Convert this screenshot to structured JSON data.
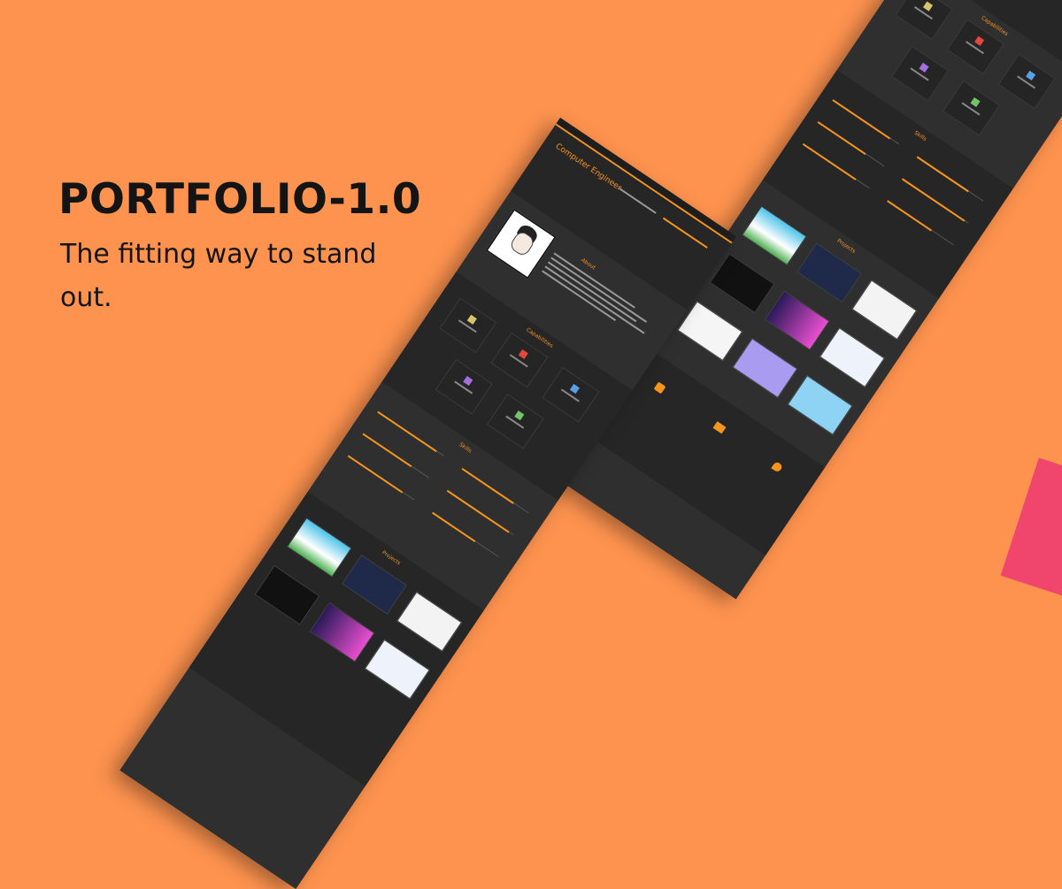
{
  "hero": {
    "title": "PORTFOLIO-1.0",
    "subtitle": "The fitting way to stand out."
  },
  "colors": {
    "background": "#FE934F",
    "accent": "#F7941D",
    "mockup_bg": "#2F2F2F",
    "pink": "#F0466E"
  },
  "mockup_front": {
    "headline": "Computer Engineer",
    "about_title": "About",
    "capabilities_title": "Capabilities",
    "skills_title": "Skills",
    "projects_title": "Projects"
  },
  "mockup_back": {
    "capabilities_title": "Capabilities",
    "skills_title": "Skills",
    "projects_title": "Projects"
  }
}
